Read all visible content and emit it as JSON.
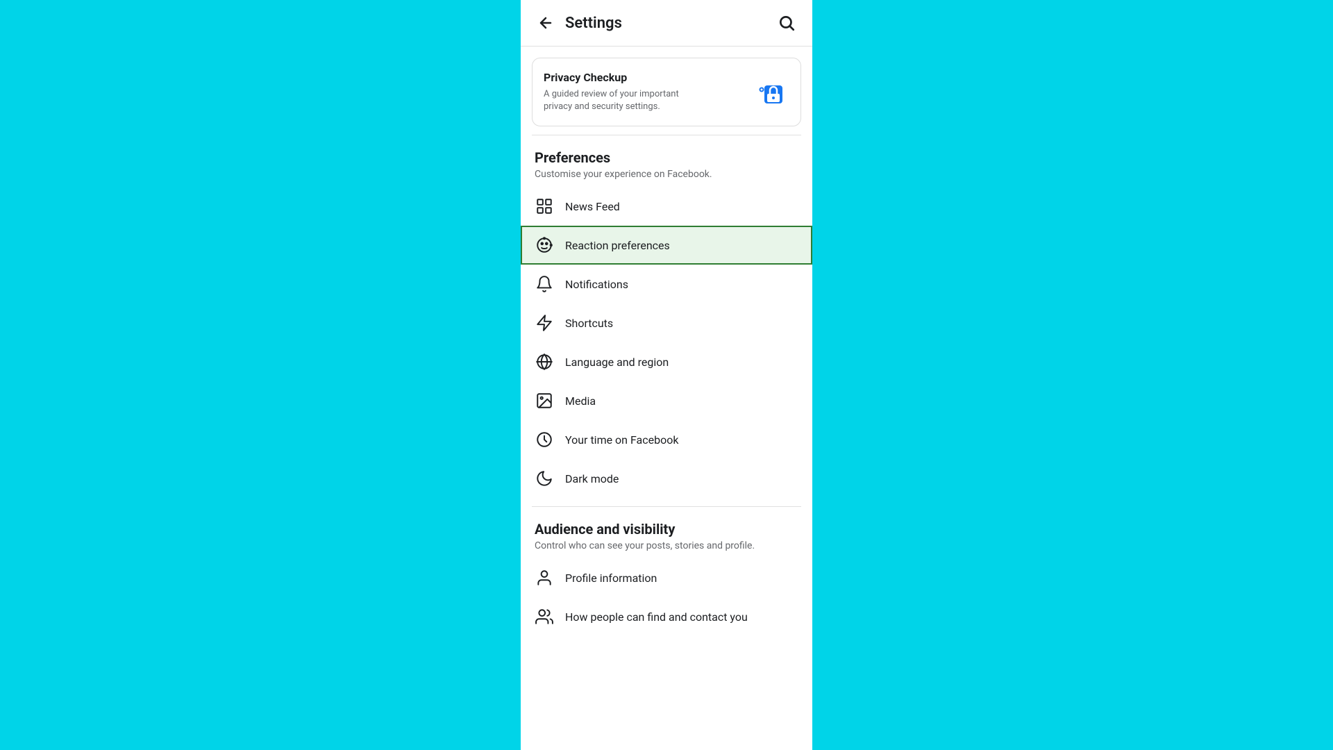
{
  "header": {
    "title": "Settings",
    "back_label": "back",
    "search_label": "search"
  },
  "privacy_checkup": {
    "title": "Privacy Checkup",
    "description": "A guided review of your important privacy and security settings."
  },
  "preferences_section": {
    "title": "Preferences",
    "subtitle": "Customise your experience on Facebook.",
    "items": [
      {
        "id": "news-feed",
        "label": "News Feed",
        "icon": "news-feed-icon",
        "active": false
      },
      {
        "id": "reaction-preferences",
        "label": "Reaction preferences",
        "icon": "reaction-icon",
        "active": true
      },
      {
        "id": "notifications",
        "label": "Notifications",
        "icon": "bell-icon",
        "active": false
      },
      {
        "id": "shortcuts",
        "label": "Shortcuts",
        "icon": "shortcuts-icon",
        "active": false
      },
      {
        "id": "language-region",
        "label": "Language and region",
        "icon": "globe-icon",
        "active": false
      },
      {
        "id": "media",
        "label": "Media",
        "icon": "media-icon",
        "active": false
      },
      {
        "id": "time-on-facebook",
        "label": "Your time on Facebook",
        "icon": "clock-icon",
        "active": false
      },
      {
        "id": "dark-mode",
        "label": "Dark mode",
        "icon": "moon-icon",
        "active": false
      }
    ]
  },
  "audience_section": {
    "title": "Audience and visibility",
    "subtitle": "Control who can see your posts, stories and profile.",
    "items": [
      {
        "id": "profile-information",
        "label": "Profile information",
        "icon": "profile-icon",
        "active": false
      },
      {
        "id": "find-contact",
        "label": "How people can find and contact you",
        "icon": "find-contact-icon",
        "active": false
      }
    ]
  }
}
